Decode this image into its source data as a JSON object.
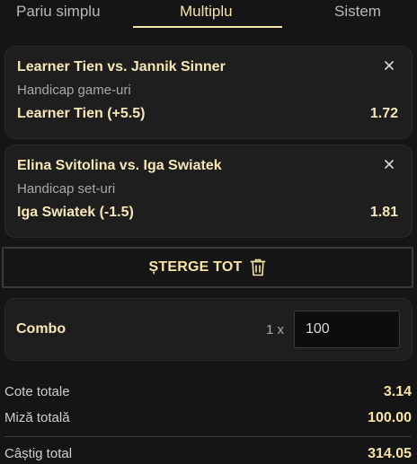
{
  "tabs": [
    {
      "label": "Pariu simplu"
    },
    {
      "label": "Multiplu"
    },
    {
      "label": "Sistem"
    }
  ],
  "bets": [
    {
      "match": "Learner Tien vs. Jannik Sinner",
      "market": "Handicap game-uri",
      "selection": "Learner Tien (+5.5)",
      "odds": "1.72"
    },
    {
      "match": "Elina Svitolina vs. Iga Swiatek",
      "market": "Handicap set-uri",
      "selection": "Iga Swiatek (-1.5)",
      "odds": "1.81"
    }
  ],
  "clear_all": {
    "label": "ȘTERGE TOT",
    "icon": "trash-icon"
  },
  "combo": {
    "label": "Combo",
    "multiplier": "1 x",
    "stake": "100"
  },
  "summary": {
    "total_odds_label": "Cote totale",
    "total_odds": "3.14",
    "total_stake_label": "Miză totală",
    "total_stake": "100.00",
    "total_win_label": "Câștig total",
    "total_win": "314.05"
  },
  "colors": {
    "accent": "#f7e3a6",
    "background": "#151515",
    "card": "#1e1e1e"
  }
}
